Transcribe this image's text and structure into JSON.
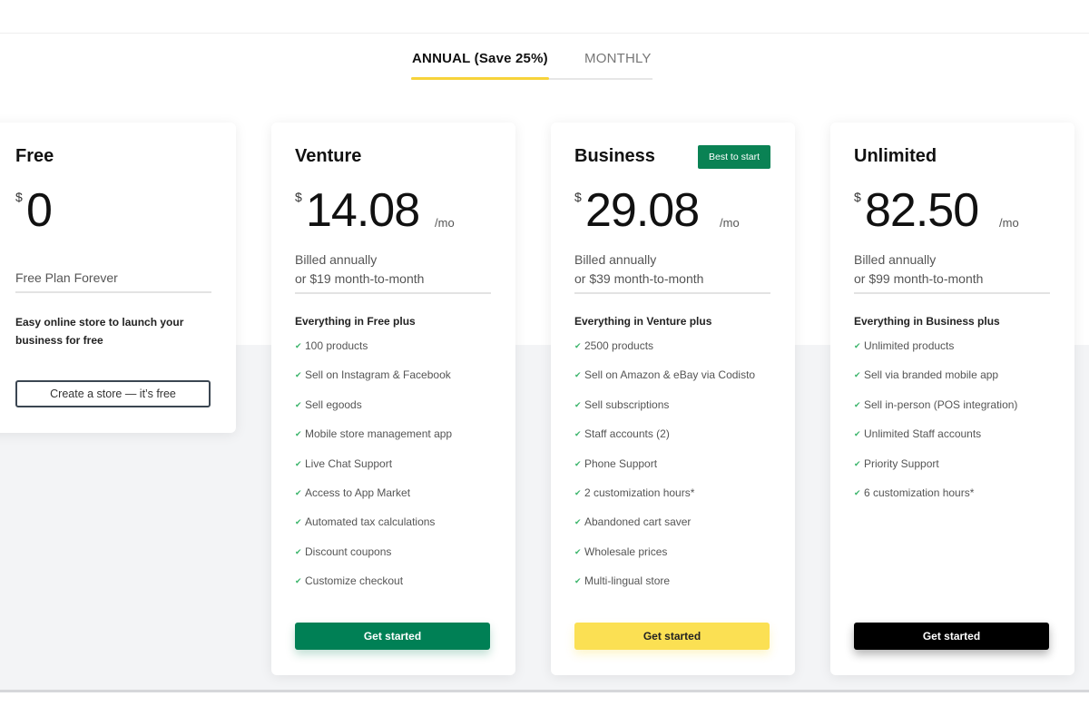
{
  "billing_tabs": [
    {
      "label": "ANNUAL (Save 25%)",
      "active": true
    },
    {
      "label": "MONTHLY",
      "active": false
    }
  ],
  "colors": {
    "accent_yellow": "#f7d33a",
    "green": "#008055",
    "yellow": "#fbe053",
    "black": "#000000"
  },
  "plans": {
    "free": {
      "name": "Free",
      "currency": "$",
      "price": "0",
      "billing": "Free Plan Forever",
      "description": "Easy online store to launch your business for free",
      "cta": "Create a store — it’s free"
    },
    "venture": {
      "name": "Venture",
      "currency": "$",
      "price": "14.08",
      "period": "/mo",
      "billing_line1": "Billed annually",
      "billing_line2": "or $19 month-to-month",
      "features_heading": "Everything in Free plus",
      "features": [
        "100 products",
        "Sell on Instagram & Facebook",
        "Sell egoods",
        "Mobile store management app",
        "Live Chat Support",
        "Access to App Market",
        "Automated tax calculations",
        "Discount coupons",
        "Customize checkout"
      ],
      "cta": "Get started"
    },
    "business": {
      "name": "Business",
      "badge": "Best to start",
      "currency": "$",
      "price": "29.08",
      "period": "/mo",
      "billing_line1": "Billed annually",
      "billing_line2": "or $39 month-to-month",
      "features_heading": "Everything in Venture plus",
      "features": [
        "2500 products",
        "Sell on Amazon & eBay via Codisto",
        "Sell subscriptions",
        "Staff accounts (2)",
        "Phone Support",
        "2 customization hours*",
        "Abandoned cart saver",
        "Wholesale prices",
        "Multi-lingual store"
      ],
      "cta": "Get started"
    },
    "unlimited": {
      "name": "Unlimited",
      "currency": "$",
      "price": "82.50",
      "period": "/mo",
      "billing_line1": "Billed annually",
      "billing_line2": "or $99 month-to-month",
      "features_heading": "Everything in Business plus",
      "features": [
        "Unlimited products",
        "Sell via branded mobile app",
        "Sell in-person (POS integration)",
        "Unlimited Staff accounts",
        "Priority Support",
        "6 customization hours*"
      ],
      "cta": "Get started"
    }
  },
  "icons": {
    "check": "✔"
  }
}
